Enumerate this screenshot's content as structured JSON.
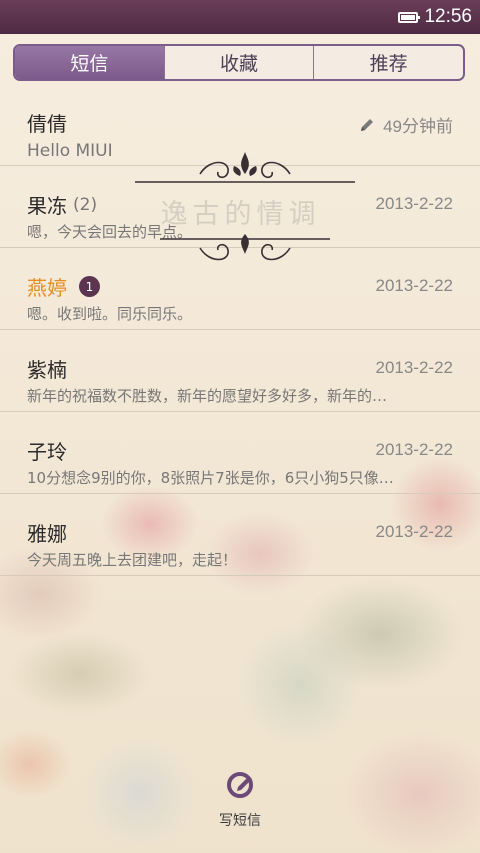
{
  "status": {
    "time": "12:56"
  },
  "tabs": [
    {
      "label": "短信",
      "active": true
    },
    {
      "label": "收藏",
      "active": false
    },
    {
      "label": "推荐",
      "active": false
    }
  ],
  "conversations": [
    {
      "name": "倩倩",
      "count": "",
      "unread_badge": "",
      "time": "49分钟前",
      "preview": "Hello MIUI"
    },
    {
      "name": "果冻",
      "count": "(2)",
      "unread_badge": "",
      "time": "2013-2-22",
      "preview": "嗯，今天会回去的早点。"
    },
    {
      "name": "燕婷",
      "count": "",
      "unread_badge": "1",
      "time": "2013-2-22",
      "preview": "嗯。收到啦。同乐同乐。"
    },
    {
      "name": "紫楠",
      "count": "",
      "unread_badge": "",
      "time": "2013-2-22",
      "preview": "新年的祝福数不胜数，新年的愿望好多好多，新年的…"
    },
    {
      "name": "子玲",
      "count": "",
      "unread_badge": "",
      "time": "2013-2-22",
      "preview": "10分想念9别的你，8张照片7张是你，6只小狗5只像…"
    },
    {
      "name": "雅娜",
      "count": "",
      "unread_badge": "",
      "time": "2013-2-22",
      "preview": "今天周五晚上去团建吧，走起！"
    }
  ],
  "watermark": "逸古的情调",
  "compose": {
    "label": "写短信"
  },
  "colors": {
    "accent": "#7d5a8c",
    "statusbar": "#5a3150",
    "unread_name": "#e88d23"
  },
  "icons": [
    "battery-icon",
    "pencil-icon",
    "compose-icon"
  ]
}
